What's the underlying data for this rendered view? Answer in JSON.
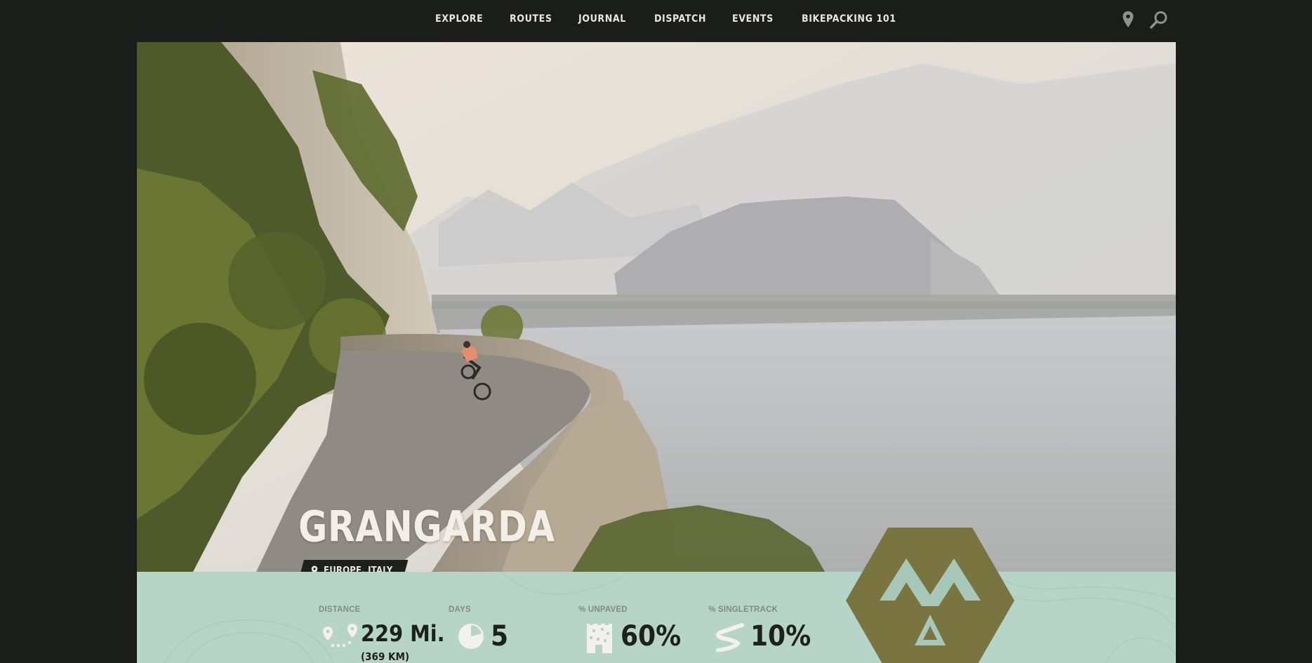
{
  "nav": {
    "links": [
      {
        "label": "EXPLORE"
      },
      {
        "label": "ROUTES"
      },
      {
        "label": "JOURNAL"
      },
      {
        "label": "DISPATCH"
      },
      {
        "label": "EVENTS"
      },
      {
        "label": "BIKEPACKING 101"
      }
    ],
    "icons": [
      "map-pin-icon",
      "search-icon"
    ]
  },
  "route": {
    "title": "GRANGARDA",
    "location": "EUROPE, ITALY"
  },
  "stats": {
    "distance": {
      "label": "DISTANCE",
      "value": "229 Mi.",
      "sub": "(369 KM)"
    },
    "days": {
      "label": "DAYS",
      "value": "5"
    },
    "unpaved": {
      "label": "% UNPAVED",
      "value": "60%"
    },
    "singletrack": {
      "label": "% SINGLETRACK",
      "value": "10%"
    }
  },
  "colors": {
    "nav_bg": "#1b1d1a",
    "stats_bg": "#b6d5c8",
    "badge_olive": "#7a7440",
    "text_dark": "#1d201c"
  }
}
